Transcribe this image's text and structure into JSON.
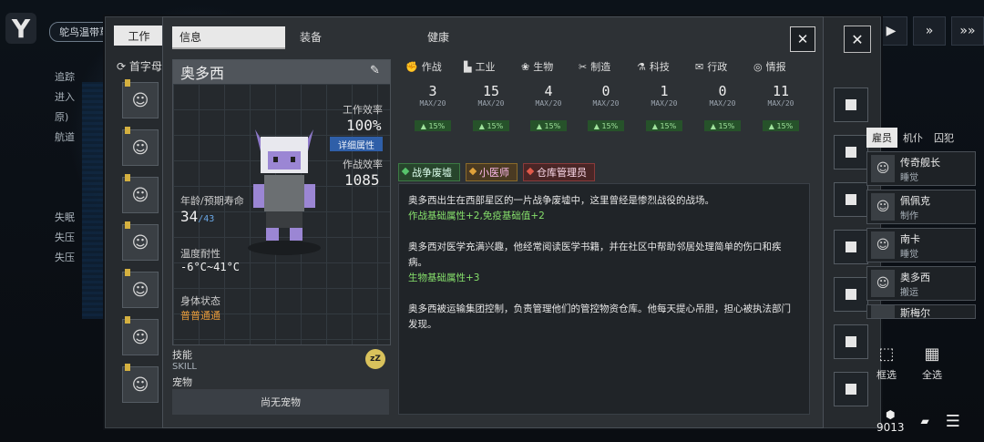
{
  "colors": {
    "accent_blue": "#2f5fa8",
    "bonus_green": "#86e06b",
    "status_orange": "#e69a3a",
    "panel_bg": "#2d3135"
  },
  "background": {
    "location": "鸵鸟温带草",
    "left_list": [
      "追踪",
      "进入",
      "原)",
      "航道",
      "失眠",
      "失压",
      "失压"
    ]
  },
  "back_window": {
    "tab": "工作",
    "sort": "首字母"
  },
  "front_panel": {
    "tabs": [
      "信息",
      "装备",
      "健康"
    ],
    "character": {
      "name": "奥多西",
      "work_eff_label": "工作效率",
      "work_eff": "100%",
      "detail_btn": "详细属性",
      "combat_eff_label": "作战效率",
      "combat_eff": "1085",
      "age_label": "年龄/预期寿命",
      "age": "34",
      "age_max": "/43",
      "temp_label": "温度耐性",
      "temp": "-6°C~41°C",
      "body_label": "身体状态",
      "body": "普普通通"
    },
    "skill_label": "技能",
    "skill_sub": "SKILL",
    "pet_label": "宠物",
    "pet_value": "尚无宠物",
    "stats": [
      {
        "label": "作战",
        "value": "3",
        "max": "MAX/20",
        "bonus": "▲ 15%",
        "icon": "fist-icon"
      },
      {
        "label": "工业",
        "value": "15",
        "max": "MAX/20",
        "bonus": "▲ 15%",
        "icon": "factory-icon"
      },
      {
        "label": "生物",
        "value": "4",
        "max": "MAX/20",
        "bonus": "▲ 15%",
        "icon": "paw-icon"
      },
      {
        "label": "制造",
        "value": "0",
        "max": "MAX/20",
        "bonus": "▲ 15%",
        "icon": "tools-icon"
      },
      {
        "label": "科技",
        "value": "1",
        "max": "MAX/20",
        "bonus": "▲ 15%",
        "icon": "flask-icon"
      },
      {
        "label": "行政",
        "value": "0",
        "max": "MAX/20",
        "bonus": "▲ 15%",
        "icon": "chat-icon"
      },
      {
        "label": "情报",
        "value": "11",
        "max": "MAX/20",
        "bonus": "▲ 15%",
        "icon": "eye-icon"
      }
    ],
    "traits": [
      {
        "label": "战争废墟",
        "tone": "green"
      },
      {
        "label": "小医师",
        "tone": "orange"
      },
      {
        "label": "仓库管理员",
        "tone": "red"
      }
    ],
    "story": {
      "p1": "奥多西出生在西部星区的一片战争废墟中，这里曾经是惨烈战役的战场。",
      "p1_bonus": "作战基础属性+2,免疫基础值+2",
      "p2": "奥多西对医学充满兴趣，他经常阅读医学书籍，并在社区中帮助邻居处理简单的伤口和疾病。",
      "p2_bonus": "生物基础属性+3",
      "p3": "奥多西被运输集团控制，负责管理他们的管控物资仓库。他每天提心吊胆，担心被执法部门发现。"
    }
  },
  "roster": {
    "tabs": [
      "雇员",
      "机仆",
      "囚犯"
    ],
    "members": [
      {
        "name": "传奇舰长",
        "status": "睡觉"
      },
      {
        "name": "佩佩克",
        "status": "制作"
      },
      {
        "name": "南卡",
        "status": "睡觉"
      },
      {
        "name": "奥多西",
        "status": "搬运"
      },
      {
        "name": "斯梅尔",
        "status": ""
      }
    ]
  },
  "tools": {
    "box_select": "框选",
    "select_all": "全选"
  },
  "resources": {
    "count": "9013"
  }
}
